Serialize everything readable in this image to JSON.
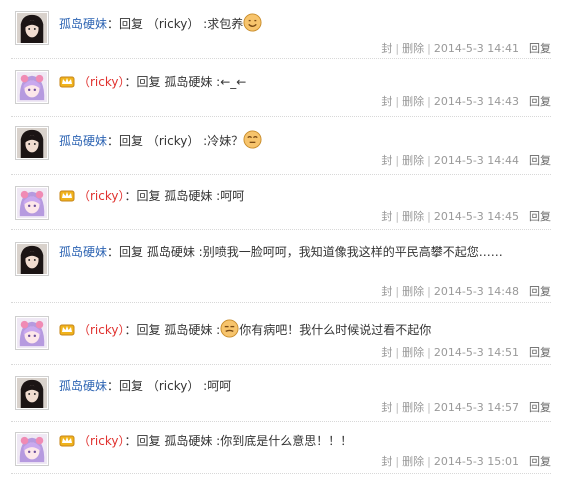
{
  "labels": {
    "seal": "封",
    "delete": "删除",
    "reply": "回复",
    "sep": "|"
  },
  "replies": [
    {
      "user": "孤岛硬妹",
      "avatar": "dark-hair-avatar",
      "prefix": "：回复 ",
      "target": "（ricky）",
      "content": " :求包养",
      "emoji": "smiley-icon",
      "time": "2014-5-3 14:41"
    },
    {
      "user": "（ricky）",
      "avatar": "pink-hair-avatar",
      "vip": "crown-icon",
      "prefix": "：回复 ",
      "target": "孤岛硬妹",
      "content": " :←_←",
      "time": "2014-5-3 14:43"
    },
    {
      "user": "孤岛硬妹",
      "avatar": "dark-hair-avatar",
      "prefix": "：回复 ",
      "target": "（ricky）",
      "content": " :冷妹？",
      "emoji": "smiley-icon",
      "time": "2014-5-3 14:44"
    },
    {
      "user": "（ricky）",
      "avatar": "pink-hair-avatar",
      "vip": "crown-icon",
      "prefix": "：回复 ",
      "target": "孤岛硬妹",
      "content": " :呵呵",
      "time": "2014-5-3 14:45"
    },
    {
      "user": "孤岛硬妹",
      "avatar": "dark-hair-avatar",
      "prefix": "：回复 ",
      "target": "孤岛硬妹",
      "content": " :别喷我一脸呵呵，我知道像我这样的平民高攀不起您……",
      "time": "2014-5-3 14:48"
    },
    {
      "user": "（ricky）",
      "avatar": "pink-hair-avatar",
      "vip": "crown-icon",
      "prefix": "：回复 ",
      "target": "孤岛硬妹",
      "content": " :",
      "emoji": "smiley-icon",
      "content_after": "你有病吧！我什么时候说过看不起你",
      "time": "2014-5-3 14:51"
    },
    {
      "user": "孤岛硬妹",
      "avatar": "dark-hair-avatar",
      "prefix": "：回复 ",
      "target": "（ricky）",
      "content": " :呵呵",
      "time": "2014-5-3 14:57"
    },
    {
      "user": "（ricky）",
      "avatar": "pink-hair-avatar",
      "vip": "crown-icon",
      "prefix": "：回复 ",
      "target": "孤岛硬妹",
      "content": " :你到底是什么意思！！！",
      "time": "2014-5-3 15:01"
    }
  ],
  "colors": {
    "username_blue": "#2d64b3",
    "username_red": "#e0312e",
    "meta_gray": "#999999"
  }
}
